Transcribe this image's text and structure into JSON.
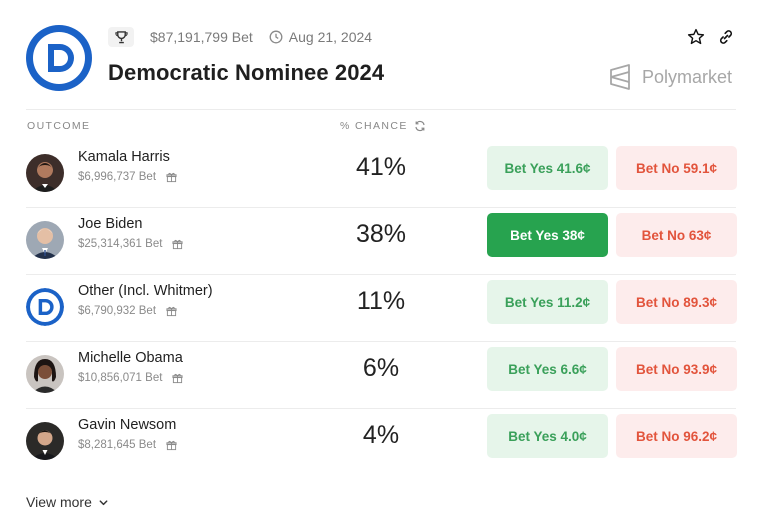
{
  "market": {
    "total_bet": "$87,191,799 Bet",
    "date": "Aug 21, 2024",
    "title": "Democratic Nominee 2024",
    "brand": "Polymarket",
    "accent_blue": "#1b62c7"
  },
  "table": {
    "outcome_header": "OUTCOME",
    "chance_header": "% CHANCE"
  },
  "rows": [
    {
      "name": "Kamala Harris",
      "bet": "$6,996,737 Bet",
      "chance": "41%",
      "yes": "Bet Yes 41.6¢",
      "no": "Bet No 59.1¢",
      "avatar": "kamala-harris-photo"
    },
    {
      "name": "Joe Biden",
      "bet": "$25,314,361 Bet",
      "chance": "38%",
      "yes": "Bet Yes 38¢",
      "no": "Bet No 63¢",
      "avatar": "joe-biden-photo"
    },
    {
      "name": "Other (Incl. Whitmer)",
      "bet": "$6,790,932 Bet",
      "chance": "11%",
      "yes": "Bet Yes 11.2¢",
      "no": "Bet No 89.3¢",
      "avatar": "democratic-logo"
    },
    {
      "name": "Michelle Obama",
      "bet": "$10,856,071 Bet",
      "chance": "6%",
      "yes": "Bet Yes 6.6¢",
      "no": "Bet No 93.9¢",
      "avatar": "michelle-obama-photo"
    },
    {
      "name": "Gavin Newsom",
      "bet": "$8,281,645 Bet",
      "chance": "4%",
      "yes": "Bet Yes 4.0¢",
      "no": "Bet No 96.2¢",
      "avatar": "gavin-newsom-photo"
    }
  ],
  "footer": {
    "view_more": "View more"
  },
  "colors": {
    "yes_bg": "#e6f5ea",
    "yes_text": "#3aa05a",
    "yes_active_bg": "#27a34f",
    "no_bg": "#fdecec",
    "no_text": "#e2543c"
  }
}
